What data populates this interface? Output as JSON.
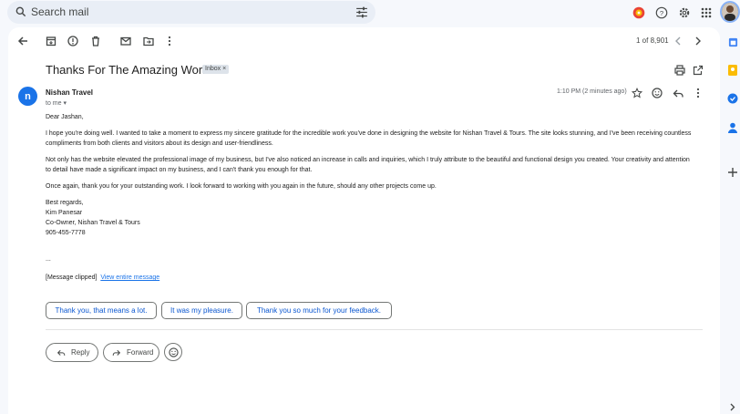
{
  "search": {
    "placeholder": "Search mail"
  },
  "thread": {
    "count": "1 of 8,901",
    "subject": "Thanks For The Amazing Work",
    "label": "Inbox",
    "label_close": "×"
  },
  "message": {
    "avatar_letter": "n",
    "sender": "Nishan Travel",
    "to": "to me",
    "time": "1:10 PM (2 minutes ago)",
    "greeting": "Dear Jashan,",
    "p1": "I hope you're doing well. I wanted to take a moment to express my sincere gratitude for the incredible work you've done in designing the website for Nishan Travel & Tours. The site looks stunning, and I've been receiving countless compliments from both clients and visitors about its design and user-friendliness.",
    "p2": "Not only has the website elevated the professional image of my business, but I've also noticed an increase in calls and inquiries, which I truly attribute to the beautiful and functional design you created. Your creativity and attention to detail have made a significant impact on my business, and I can't thank you enough for that.",
    "p3": "Once again, thank you for your outstanding work. I look forward to working with you again in the future, should any other projects come up.",
    "sign1": "Best regards,",
    "sign2": "Kim Panesar",
    "sign3": "Co-Owner, Nishan Travel & Tours",
    "sign4": "905-455-7778",
    "ellipsis": "...",
    "clipped_text": "[Message clipped]",
    "clipped_link": "View entire message"
  },
  "smart_replies": [
    "Thank you, that means a lot.",
    "It was my pleasure.",
    "Thank you so much for your feedback."
  ],
  "actions": {
    "reply": "Reply",
    "forward": "Forward"
  },
  "colors": {
    "accent": "#0b57d0",
    "avatar": "#1a73e8",
    "background": "#f6f8fc"
  },
  "icons": [
    "search-icon",
    "filter-icon",
    "gemini-icon",
    "help-icon",
    "settings-icon",
    "apps-icon",
    "back-icon",
    "archive-icon",
    "report-spam-icon",
    "delete-icon",
    "mark-unread-icon",
    "move-to-icon",
    "more-icon",
    "print-icon",
    "open-in-new-icon",
    "star-icon",
    "emoji-icon",
    "reply-icon",
    "calendar-icon",
    "keep-icon",
    "tasks-icon",
    "contacts-icon",
    "add-icon"
  ]
}
